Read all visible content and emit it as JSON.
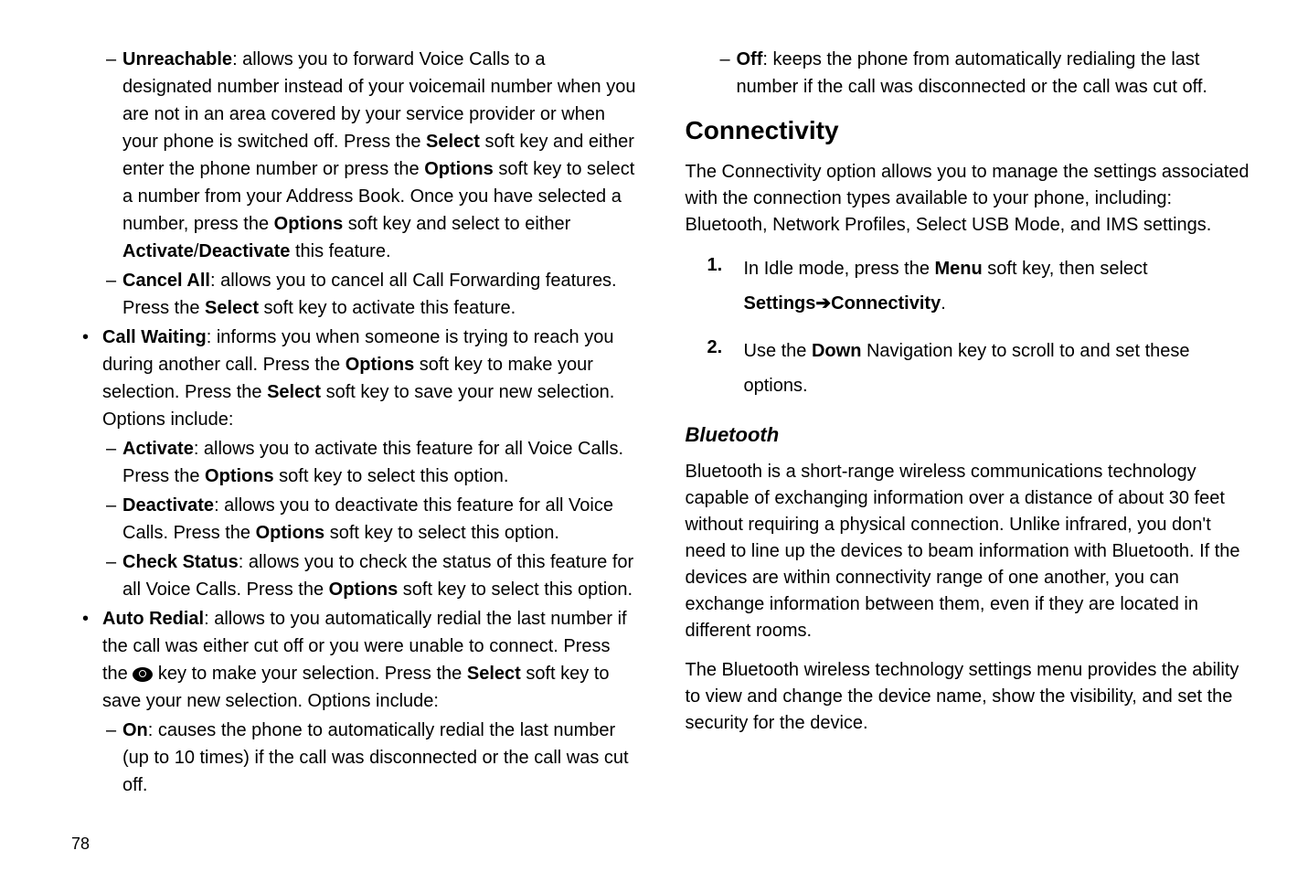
{
  "pageNumber": "78",
  "left": {
    "unreachable": {
      "label": "Unreachable",
      "text1": ": allows you to forward Voice Calls to a designated number instead of your voicemail number when you are not in an area covered by your service provider or when your phone is switched off. Press the ",
      "select": "Select",
      "text2": " soft key and either enter the phone number or press the ",
      "options1": "Options",
      "text3": " soft key to select a number from your Address Book. Once you have selected a number, press the ",
      "options2": "Options",
      "text4": " soft key and select to either ",
      "activate": "Activate",
      "slash": "/",
      "deactivate": "Deactivate",
      "text5": " this feature."
    },
    "cancelAll": {
      "label": "Cancel All",
      "text1": ": allows you to cancel all Call Forwarding features. Press the ",
      "select": "Select",
      "text2": " soft key to activate this feature."
    },
    "callWaiting": {
      "label": "Call Waiting",
      "text1": ": informs you when someone is trying to reach you during another call. Press the ",
      "options": "Options",
      "text2": " soft key to make your selection. Press the ",
      "select": "Select",
      "text3": " soft key to save your new selection. Options include:"
    },
    "cwActivate": {
      "label": "Activate",
      "text1": ": allows you to activate this feature for all Voice Calls. Press the ",
      "options": "Options",
      "text2": " soft key to select this option."
    },
    "cwDeactivate": {
      "label": "Deactivate",
      "text1": ": allows you to deactivate this feature for all Voice Calls. Press the ",
      "options": "Options",
      "text2": " soft key to select this option."
    },
    "cwCheck": {
      "label": "Check Status",
      "text1": ": allows you to check the status of this feature for all Voice Calls. Press the ",
      "options": "Options",
      "text2": " soft key to select this option."
    },
    "autoRedial": {
      "label": "Auto Redial",
      "text1": ": allows to you automatically redial the last number if the call was either cut off or you were unable to connect. Press the ",
      "text2": " key to make your selection. Press the ",
      "select": "Select",
      "text3": " soft key to save your new selection. Options include:"
    },
    "arOn": {
      "label": "On",
      "text": ": causes the phone to automatically redial the last number (up to 10 times) if the call was disconnected or the call was cut off."
    }
  },
  "right": {
    "arOff": {
      "label": "Off",
      "text": ": keeps the phone from automatically redialing the last number if the call was disconnected or the call was cut off."
    },
    "connectivityHeading": "Connectivity",
    "connectivityPara": "The Connectivity option allows you to manage the settings associated with the connection types available to your phone, including: Bluetooth, Network Profiles, Select USB Mode, and IMS settings.",
    "step1": {
      "num": "1.",
      "text1": "In Idle mode, press the ",
      "menu": "Menu",
      "text2": " soft key, then select ",
      "settings": "Settings",
      "arrow": " ➔ ",
      "connectivity": "Connectivity",
      "period": "."
    },
    "step2": {
      "num": "2.",
      "text1": "Use the ",
      "down": "Down",
      "text2": " Navigation key to scroll to and set these options."
    },
    "bluetoothHeading": "Bluetooth",
    "bluetoothPara1": "Bluetooth is a short-range wireless communications technology capable of exchanging information over a distance of about 30 feet without requiring a physical connection. Unlike infrared, you don't need to line up the devices to beam information with Bluetooth. If the devices are within connectivity range of one another, you can exchange information between them, even if they are located in different rooms.",
    "bluetoothPara2": "The Bluetooth wireless technology settings menu provides the ability to view and change the device name, show the visibility, and set the security for the device."
  }
}
